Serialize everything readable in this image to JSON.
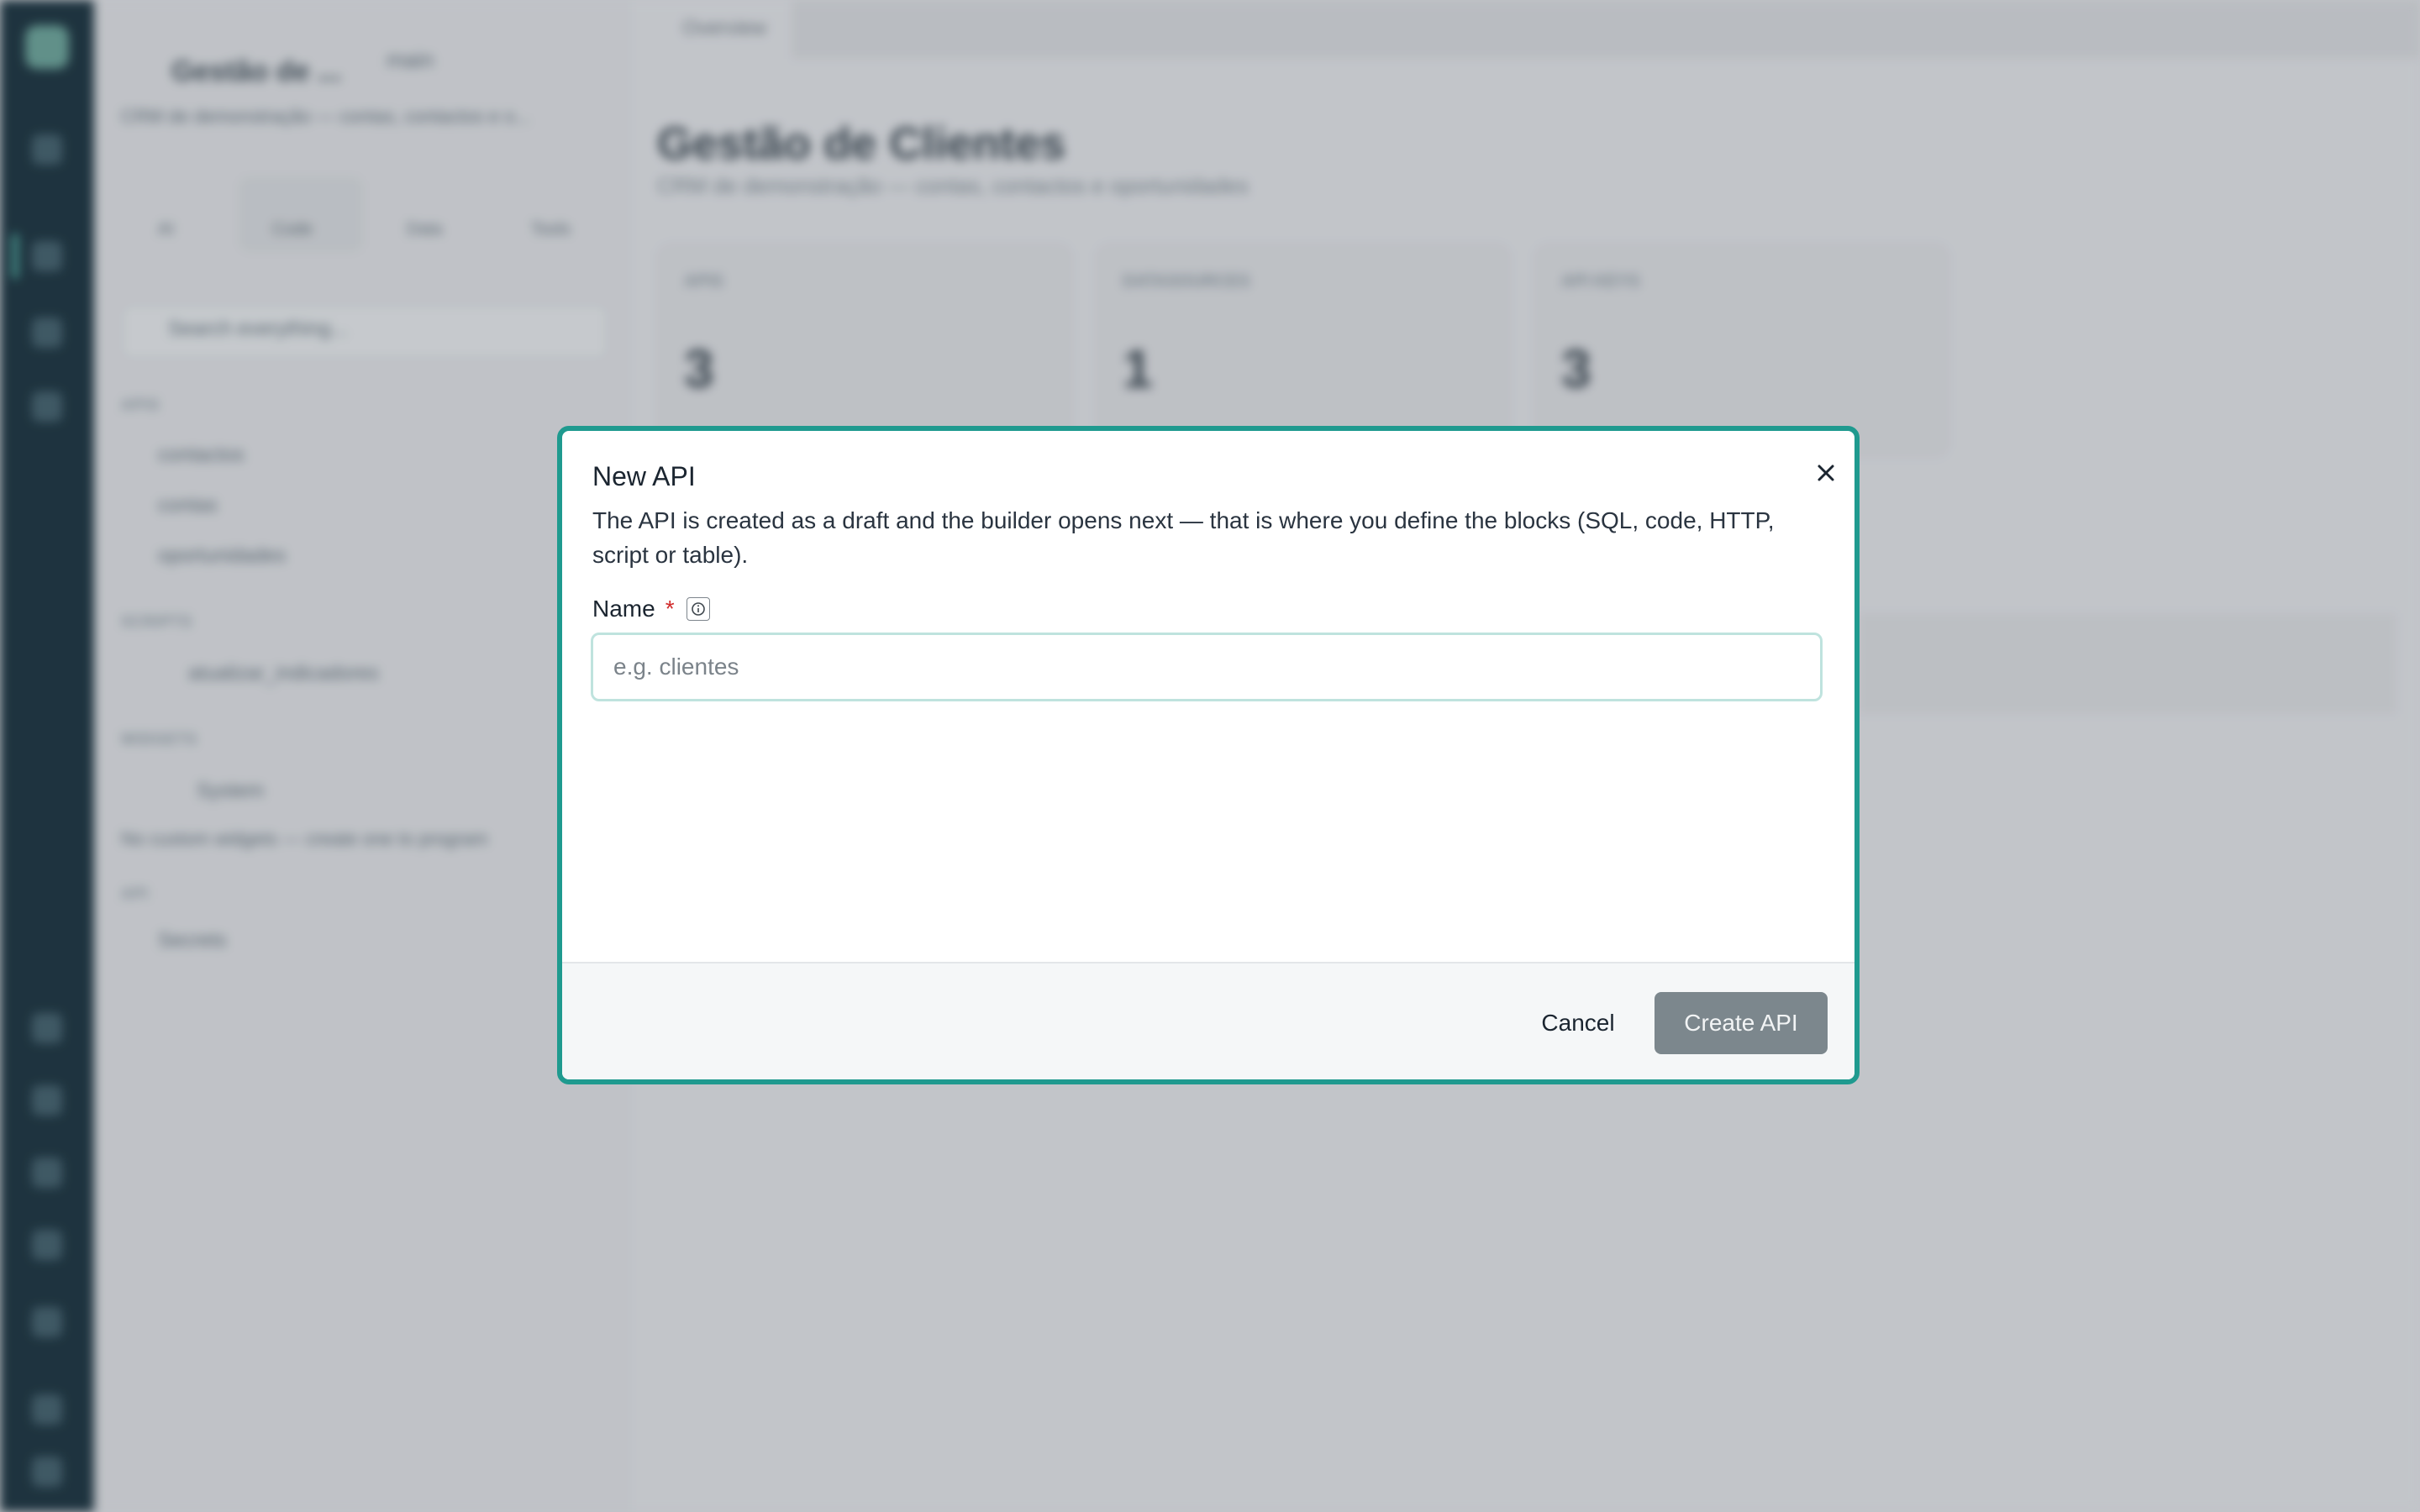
{
  "background": {
    "project": {
      "name": "Gestão de ...",
      "description": "CRM de demonstração — contas, contactos e o...",
      "branch": "main"
    },
    "sidebar_tabs": [
      "AI",
      "Code",
      "Data",
      "Tools"
    ],
    "search_placeholder": "Search everything...",
    "sections": {
      "apis": {
        "heading": "APIS",
        "items": [
          "contactos",
          "contas",
          "oportunidades"
        ]
      },
      "scripts": {
        "heading": "SCRIPTS",
        "items": [
          "atualizar_indicadores"
        ]
      },
      "widgets": {
        "heading": "WIDGETS",
        "items": [
          "System"
        ],
        "empty_text": "No custom widgets — create one to program"
      },
      "api": {
        "heading": "API",
        "items": [
          "Secrets"
        ]
      }
    },
    "main": {
      "tab": "Overview",
      "title": "Gestão de Clientes",
      "subtitle": "CRM de demonstração — contas, contactos e oportunidades",
      "cards": [
        {
          "label": "APIS",
          "value": "3"
        },
        {
          "label": "DATASOURCES",
          "value": "1"
        },
        {
          "label": "API KEYS",
          "value": "3"
        }
      ]
    }
  },
  "modal": {
    "title": "New API",
    "description": "The API is created as a draft and the builder opens next — that is where you define the blocks (SQL, code, HTTP, script or table).",
    "name_label": "Name",
    "required_mark": "*",
    "name_placeholder": "e.g. clientes",
    "name_value": "",
    "cancel_label": "Cancel",
    "create_label": "Create API",
    "colors": {
      "accent": "#1f9a8f",
      "primary_disabled": "#7c878d",
      "required": "#d12b2b"
    }
  }
}
